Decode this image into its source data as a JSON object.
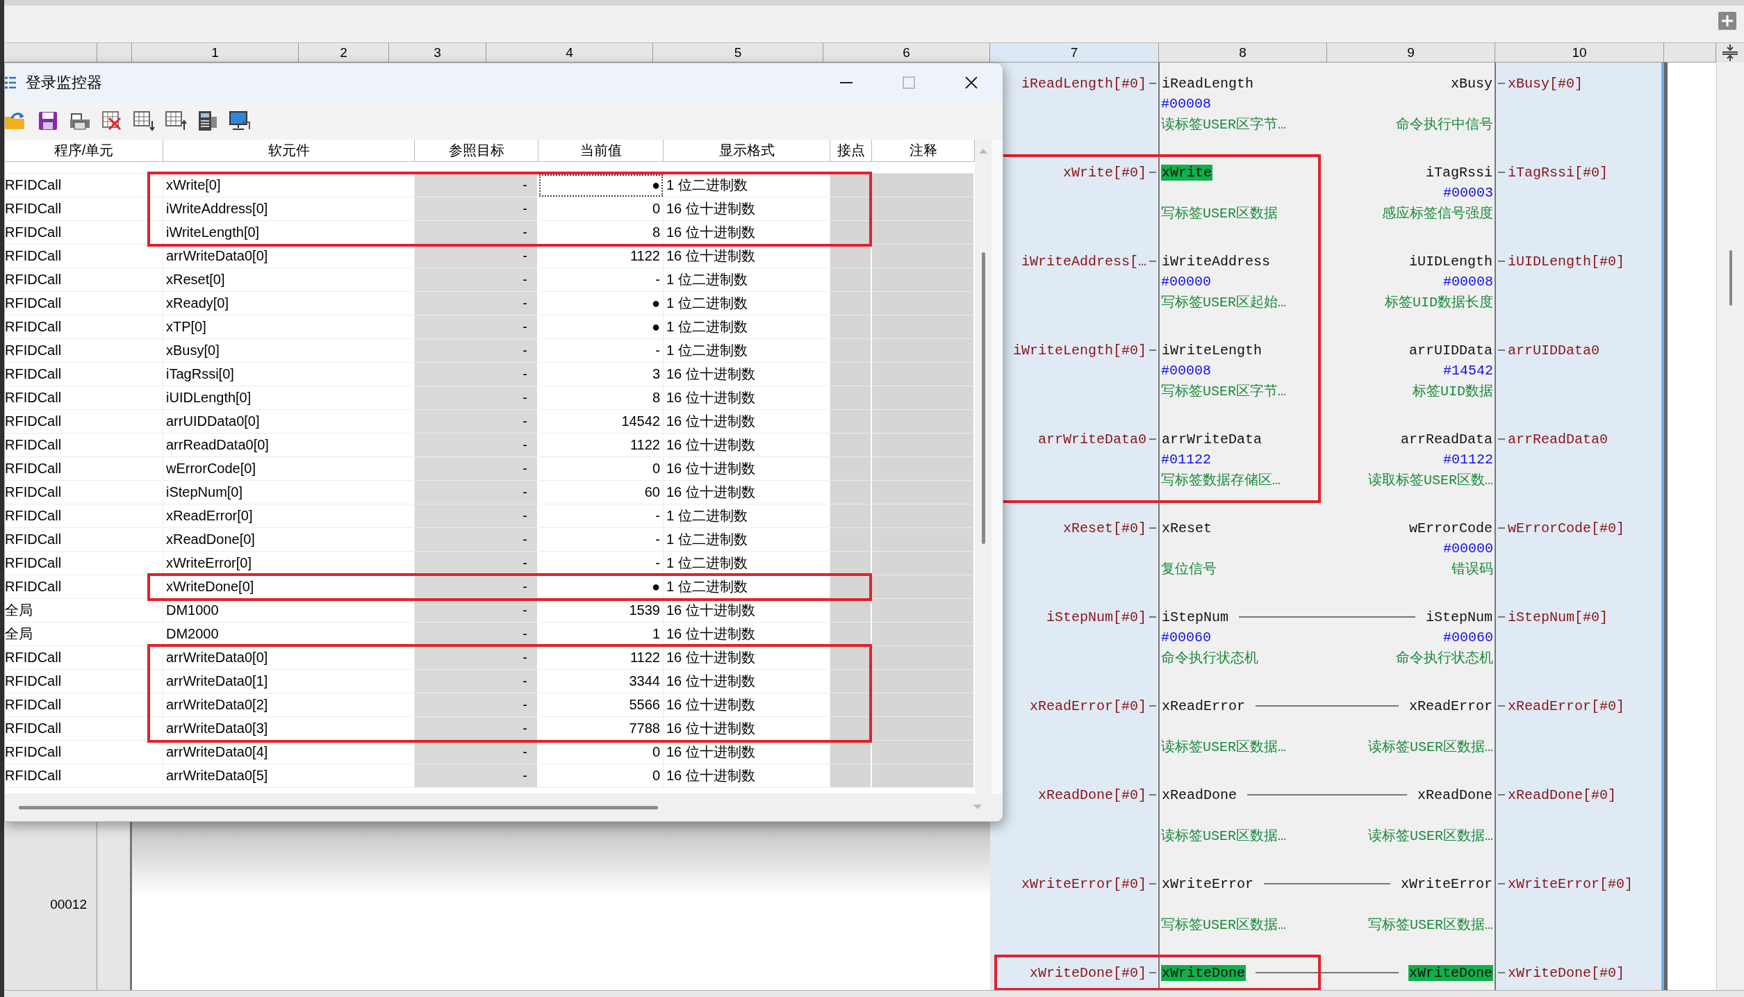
{
  "column_header": [
    {
      "label": "1",
      "selected": false
    },
    {
      "label": "2",
      "selected": false
    },
    {
      "label": "3",
      "selected": false
    },
    {
      "label": "4",
      "selected": false
    },
    {
      "label": "5",
      "selected": false
    },
    {
      "label": "6",
      "selected": false
    },
    {
      "label": "7",
      "selected": true
    },
    {
      "label": "8",
      "selected": false
    },
    {
      "label": "9",
      "selected": false
    },
    {
      "label": "10",
      "selected": false
    }
  ],
  "ladder": {
    "rung_number": "00012",
    "pins": [
      {
        "in": {
          "variable": "iReadLength[#0]",
          "pin": "iReadLength",
          "value": "#00008",
          "comment": "读标签USER区字节…",
          "active": false
        },
        "out": {
          "pin": "xBusy",
          "comment": "命令执行中信号",
          "variable": "xBusy[#0]",
          "active": false
        },
        "wired": false,
        "framed": false
      },
      {
        "in": {
          "variable": "xWrite[#0]",
          "pin": "xWrite",
          "comment": "写标签USER区数据",
          "active": true
        },
        "out": {
          "pin": "iTagRssi",
          "value": "#00003",
          "comment": "感应标签信号强度",
          "variable": "iTagRssi[#0]",
          "active": false
        },
        "wired": false,
        "framed": true
      },
      {
        "in": {
          "variable": "iWriteAddress[…",
          "pin": "iWriteAddress",
          "value": "#00000",
          "comment": "写标签USER区起始…",
          "active": false
        },
        "out": {
          "pin": "iUIDLength",
          "value": "#00008",
          "comment": "标签UID数据长度",
          "variable": "iUIDLength[#0]",
          "active": false
        },
        "wired": false,
        "framed": true
      },
      {
        "in": {
          "variable": "iWriteLength[#0]",
          "pin": "iWriteLength",
          "value": "#00008",
          "comment": "写标签USER区字节…",
          "active": false
        },
        "out": {
          "pin": "arrUIDData",
          "value": "#14542",
          "comment": "标签UID数据",
          "variable": "arrUIDData0",
          "active": false
        },
        "wired": false,
        "framed": true
      },
      {
        "in": {
          "variable": "arrWriteData0",
          "pin": "arrWriteData",
          "value": "#01122",
          "comment": "写标签数据存储区…",
          "active": false
        },
        "out": {
          "pin": "arrReadData",
          "value": "#01122",
          "comment": "读取标签USER区数…",
          "variable": "arrReadData0",
          "active": false
        },
        "wired": false,
        "framed": true
      },
      {
        "in": {
          "variable": "xReset[#0]",
          "pin": "xReset",
          "comment": "复位信号",
          "active": false
        },
        "out": {
          "pin": "wErrorCode",
          "value": "#00000",
          "comment": "错误码",
          "variable": "wErrorCode[#0]",
          "active": false
        },
        "wired": false,
        "framed": false
      },
      {
        "in": {
          "variable": "iStepNum[#0]",
          "pin": "iStepNum",
          "value": "#00060",
          "comment": "命令执行状态机",
          "active": false
        },
        "out": {
          "pin": "iStepNum",
          "value": "#00060",
          "comment": "命令执行状态机",
          "variable": "iStepNum[#0]",
          "active": false
        },
        "wired": true,
        "framed": false
      },
      {
        "in": {
          "variable": "xReadError[#0]",
          "pin": "xReadError",
          "comment": "读标签USER区数据…",
          "active": false
        },
        "out": {
          "pin": "xReadError",
          "comment": "读标签USER区数据…",
          "variable": "xReadError[#0]",
          "active": false
        },
        "wired": true,
        "framed": false
      },
      {
        "in": {
          "variable": "xReadDone[#0]",
          "pin": "xReadDone",
          "comment": "读标签USER区数据…",
          "active": false
        },
        "out": {
          "pin": "xReadDone",
          "comment": "读标签USER区数据…",
          "variable": "xReadDone[#0]",
          "active": false
        },
        "wired": true,
        "framed": false
      },
      {
        "in": {
          "variable": "xWriteError[#0]",
          "pin": "xWriteError",
          "comment": "写标签USER区数据…",
          "active": false
        },
        "out": {
          "pin": "xWriteError",
          "comment": "写标签USER区数据…",
          "variable": "xWriteError[#0]",
          "active": false
        },
        "wired": true,
        "framed": false
      },
      {
        "in": {
          "variable": "xWriteDone[#0]",
          "pin": "xWriteDone",
          "active": true
        },
        "out": {
          "pin": "xWriteDone",
          "variable": "xWriteDone[#0]",
          "active": true
        },
        "wired": true,
        "framed": true
      }
    ]
  },
  "monitor_window": {
    "title": "登录监控器",
    "columns": [
      "程序/单元",
      "软元件",
      "参照目标",
      "当前值",
      "显示格式",
      "接点",
      "注释"
    ],
    "rows": [
      {
        "program": "RFIDCall",
        "device": "xWrite[0]",
        "reference": "-",
        "value": "●",
        "format": "1 位二进制数",
        "selected": true,
        "framed": true
      },
      {
        "program": "RFIDCall",
        "device": "iWriteAddress[0]",
        "reference": "-",
        "value": "0",
        "format": "16 位十进制数",
        "selected": false,
        "framed": true
      },
      {
        "program": "RFIDCall",
        "device": "iWriteLength[0]",
        "reference": "-",
        "value": "8",
        "format": "16 位十进制数",
        "selected": false,
        "framed": true
      },
      {
        "program": "RFIDCall",
        "device": "arrWriteData0[0]",
        "reference": "-",
        "value": "1122",
        "format": "16 位十进制数",
        "selected": false,
        "framed": false
      },
      {
        "program": "RFIDCall",
        "device": "xReset[0]",
        "reference": "-",
        "value": "-",
        "format": "1 位二进制数",
        "selected": false,
        "framed": false
      },
      {
        "program": "RFIDCall",
        "device": "xReady[0]",
        "reference": "-",
        "value": "●",
        "format": "1 位二进制数",
        "selected": false,
        "framed": false
      },
      {
        "program": "RFIDCall",
        "device": "xTP[0]",
        "reference": "-",
        "value": "●",
        "format": "1 位二进制数",
        "selected": false,
        "framed": false
      },
      {
        "program": "RFIDCall",
        "device": "xBusy[0]",
        "reference": "-",
        "value": "-",
        "format": "1 位二进制数",
        "selected": false,
        "framed": false
      },
      {
        "program": "RFIDCall",
        "device": "iTagRssi[0]",
        "reference": "-",
        "value": "3",
        "format": "16 位十进制数",
        "selected": false,
        "framed": false
      },
      {
        "program": "RFIDCall",
        "device": "iUIDLength[0]",
        "reference": "-",
        "value": "8",
        "format": "16 位十进制数",
        "selected": false,
        "framed": false
      },
      {
        "program": "RFIDCall",
        "device": "arrUIDData0[0]",
        "reference": "-",
        "value": "14542",
        "format": "16 位十进制数",
        "selected": false,
        "framed": false
      },
      {
        "program": "RFIDCall",
        "device": "arrReadData0[0]",
        "reference": "-",
        "value": "1122",
        "format": "16 位十进制数",
        "selected": false,
        "framed": false
      },
      {
        "program": "RFIDCall",
        "device": "wErrorCode[0]",
        "reference": "-",
        "value": "0",
        "format": "16 位十进制数",
        "selected": false,
        "framed": false
      },
      {
        "program": "RFIDCall",
        "device": "iStepNum[0]",
        "reference": "-",
        "value": "60",
        "format": "16 位十进制数",
        "selected": false,
        "framed": false
      },
      {
        "program": "RFIDCall",
        "device": "xReadError[0]",
        "reference": "-",
        "value": "-",
        "format": "1 位二进制数",
        "selected": false,
        "framed": false
      },
      {
        "program": "RFIDCall",
        "device": "xReadDone[0]",
        "reference": "-",
        "value": "-",
        "format": "1 位二进制数",
        "selected": false,
        "framed": false
      },
      {
        "program": "RFIDCall",
        "device": "xWriteError[0]",
        "reference": "-",
        "value": "-",
        "format": "1 位二进制数",
        "selected": false,
        "framed": false
      },
      {
        "program": "RFIDCall",
        "device": "xWriteDone[0]",
        "reference": "-",
        "value": "●",
        "format": "1 位二进制数",
        "selected": false,
        "framed": true
      },
      {
        "program": "全局",
        "device": "DM1000",
        "reference": "-",
        "value": "1539",
        "format": "16 位十进制数",
        "selected": false,
        "framed": false
      },
      {
        "program": "全局",
        "device": "DM2000",
        "reference": "-",
        "value": "1",
        "format": "16 位十进制数",
        "selected": false,
        "framed": false
      },
      {
        "program": "RFIDCall",
        "device": "arrWriteData0[0]",
        "reference": "-",
        "value": "1122",
        "format": "16 位十进制数",
        "selected": false,
        "framed": true
      },
      {
        "program": "RFIDCall",
        "device": "arrWriteData0[1]",
        "reference": "-",
        "value": "3344",
        "format": "16 位十进制数",
        "selected": false,
        "framed": true
      },
      {
        "program": "RFIDCall",
        "device": "arrWriteData0[2]",
        "reference": "-",
        "value": "5566",
        "format": "16 位十进制数",
        "selected": false,
        "framed": true
      },
      {
        "program": "RFIDCall",
        "device": "arrWriteData0[3]",
        "reference": "-",
        "value": "7788",
        "format": "16 位十进制数",
        "selected": false,
        "framed": true
      },
      {
        "program": "RFIDCall",
        "device": "arrWriteData0[4]",
        "reference": "-",
        "value": "0",
        "format": "16 位十进制数",
        "selected": false,
        "framed": false
      },
      {
        "program": "RFIDCall",
        "device": "arrWriteData0[5]",
        "reference": "-",
        "value": "0",
        "format": "16 位十进制数",
        "selected": false,
        "framed": false
      }
    ]
  }
}
